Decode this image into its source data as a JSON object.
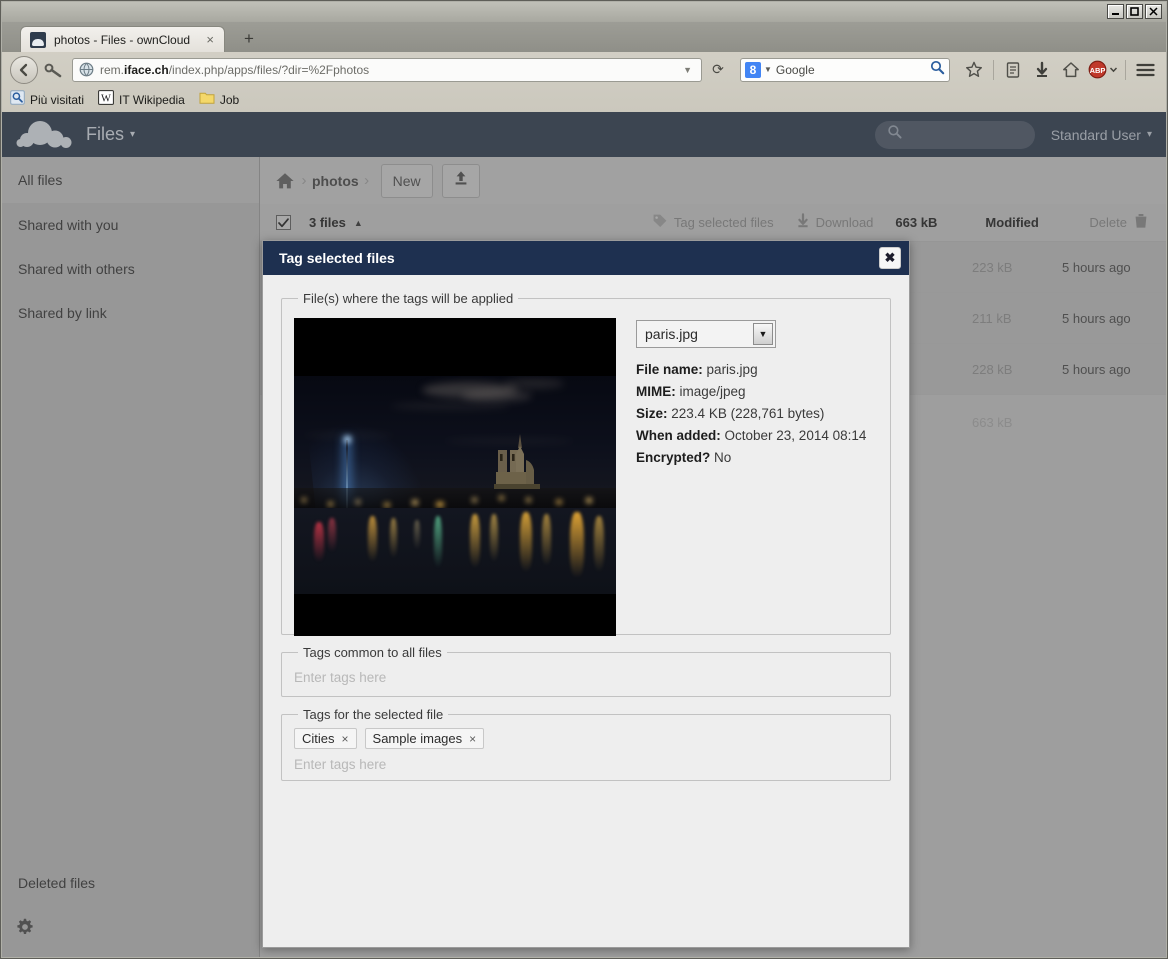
{
  "window": {
    "minimize_label": "minimize",
    "maximize_label": "maximize",
    "close_label": "close"
  },
  "browser": {
    "tab": {
      "title": "photos - Files - ownCloud",
      "close_label": "×"
    },
    "new_tab_label": "+",
    "url": {
      "prefix": "rem.",
      "host_bold": "iface.ch",
      "path": "/index.php/apps/files/?dir=%2Fphotos"
    },
    "url_dropmarker": "▼",
    "reload_label": "⟳",
    "search": {
      "engine_letter": "8",
      "engine_caret": "▼",
      "placeholder": "Google"
    },
    "bookmarks": [
      {
        "label": "Più visitati",
        "icon": "most-visited-icon"
      },
      {
        "label": "IT Wikipedia",
        "icon": "wikipedia-icon"
      },
      {
        "label": "Job",
        "icon": "folder-icon"
      }
    ],
    "toolbar_icons": [
      "bookmark-star-icon",
      "reader-list-icon",
      "downloads-icon",
      "home-icon",
      "adblock-plus-icon",
      "menu-icon"
    ],
    "adblock_label": "ABP"
  },
  "owncloud": {
    "app_name": "Files",
    "app_caret": "▾",
    "search_placeholder": "",
    "user_name": "Standard User",
    "user_caret": "▾",
    "sidebar": [
      {
        "label": "All files"
      },
      {
        "label": "Shared with you"
      },
      {
        "label": "Shared with others"
      },
      {
        "label": "Shared by link"
      }
    ],
    "sidebar_deleted": "Deleted files",
    "breadcrumb": {
      "home": "home-icon",
      "current": "photos",
      "separator": "›"
    },
    "buttons": {
      "new": "New",
      "upload": "upload-icon"
    },
    "filelist_header": {
      "count": "3 files",
      "sort_arrow": "▲",
      "tag_action": "Tag selected files",
      "download_action": "Download",
      "size": "663 kB",
      "modified": "Modified",
      "delete": "Delete"
    },
    "rows": [
      {
        "size": "223 kB",
        "modified": "5 hours ago"
      },
      {
        "size": "211 kB",
        "modified": "5 hours ago"
      },
      {
        "size": "228 kB",
        "modified": "5 hours ago"
      }
    ],
    "summary": {
      "size": "663 kB"
    }
  },
  "dialog": {
    "title": "Tag selected files",
    "close_label": "✖",
    "files_legend": "File(s) where the tags will be applied",
    "selected_file": "paris.jpg",
    "select_caret": "▼",
    "meta": [
      {
        "label": "File name:",
        "value": "paris.jpg"
      },
      {
        "label": "MIME:",
        "value": "image/jpeg"
      },
      {
        "label": "Size:",
        "value": "223.4 KB (228,761 bytes)"
      },
      {
        "label": "When added:",
        "value": "October 23, 2014 08:14"
      },
      {
        "label": "Encrypted?",
        "value": "No"
      }
    ],
    "tags_common_legend": "Tags common to all files",
    "tags_common_placeholder": "Enter tags here",
    "tags_file_legend": "Tags for the selected file",
    "tags_file_placeholder": "Enter tags here",
    "tags": [
      {
        "label": "Cities",
        "remove": "×"
      },
      {
        "label": "Sample images",
        "remove": "×"
      }
    ]
  },
  "colors": {
    "oc_header": "#45505f",
    "dialog_title": "#1e3050",
    "sidebar": "#b4b4b4"
  }
}
